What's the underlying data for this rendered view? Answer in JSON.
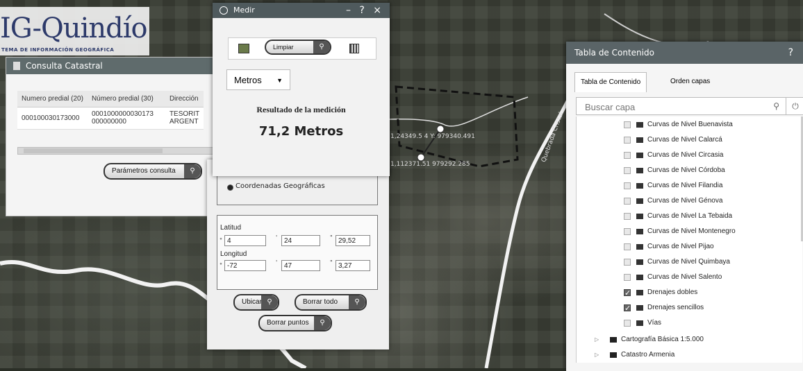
{
  "logo": {
    "title": "IG-Quindío",
    "subtitle": "TEMA DE INFORMACIÓN GEOGRÁFICA"
  },
  "consulta": {
    "title": "Consulta Catastral",
    "columns": [
      "Numero predial (20)",
      "Número predial (30)",
      "Dirección"
    ],
    "row": [
      "000100030173000",
      "0001000000030173 000000000",
      "TESORIT ARGENT"
    ],
    "params_button": "Parámetros consulta"
  },
  "medir": {
    "title": "Medir",
    "controls": "– ? ×",
    "clear_button": "Limpiar",
    "unit": "Metros",
    "result_label": "Resultado de la medición",
    "result_value": "71,2 Metros"
  },
  "coords": {
    "radio_label": "Coordenadas Geográficas",
    "lat_label": "Latitud",
    "lat": {
      "deg": "4",
      "min": "24",
      "sec": "29,52"
    },
    "lon_label": "Longitud",
    "lon": {
      "deg": "-72",
      "min": "47",
      "sec": "3,27"
    },
    "ubicar": "Ubicar",
    "borrar_todo": "Borrar todo",
    "borrar_puntos": "Borrar puntos"
  },
  "map": {
    "coord1": "1,24349.5 4 Y: 979340.491",
    "coord2": "1,112371.51 979292.285",
    "river_label": "Quebrada Cristal"
  },
  "toc": {
    "title": "Tabla de Contenido",
    "help": "?",
    "tabs": [
      "Tabla de Contenido",
      "Orden capas"
    ],
    "search_placeholder": "Buscar capa",
    "layers": [
      {
        "name": "Curvas de Nivel Buenavista",
        "checked": false
      },
      {
        "name": "Curvas de Nivel Calarcá",
        "checked": false
      },
      {
        "name": "Curvas de Nivel Circasia",
        "checked": false
      },
      {
        "name": "Curvas de Nivel Córdoba",
        "checked": false
      },
      {
        "name": "Curvas de Nivel Filandia",
        "checked": false
      },
      {
        "name": "Curvas de Nivel Génova",
        "checked": false
      },
      {
        "name": "Curvas de Nivel La Tebaida",
        "checked": false
      },
      {
        "name": "Curvas de Nivel Montenegro",
        "checked": false
      },
      {
        "name": "Curvas de Nivel Pijao",
        "checked": false
      },
      {
        "name": "Curvas de Nivel Quimbaya",
        "checked": false
      },
      {
        "name": "Curvas de Nivel Salento",
        "checked": false
      },
      {
        "name": "Drenajes dobles",
        "checked": true
      },
      {
        "name": "Drenajes sencillos",
        "checked": true
      },
      {
        "name": "Vías",
        "checked": false
      }
    ],
    "groups": [
      "Cartografía Básica 1:5.000",
      "Catastro Armenia"
    ]
  }
}
